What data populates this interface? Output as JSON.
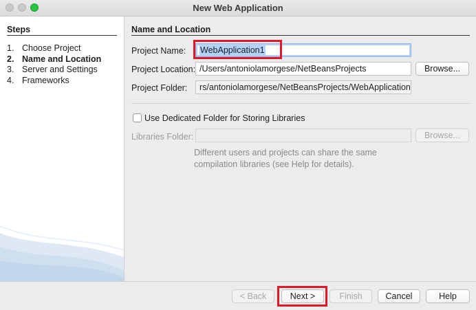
{
  "window": {
    "title": "New Web Application"
  },
  "steps": {
    "heading": "Steps",
    "items": [
      {
        "num": "1.",
        "label": "Choose Project"
      },
      {
        "num": "2.",
        "label": "Name and Location"
      },
      {
        "num": "3.",
        "label": "Server and Settings"
      },
      {
        "num": "4.",
        "label": "Frameworks"
      }
    ],
    "active_index": 1
  },
  "form": {
    "heading": "Name and Location",
    "project_name_label": "Project Name:",
    "project_name_value": "WebApplication1",
    "project_location_label": "Project Location:",
    "project_location_value": "/Users/antoniolamorgese/NetBeansProjects",
    "project_folder_label": "Project Folder:",
    "project_folder_value": "rs/antoniolamorgese/NetBeansProjects/WebApplication1",
    "browse_label": "Browse...",
    "dedicated_folder_label": "Use Dedicated Folder for Storing Libraries",
    "dedicated_folder_checked": false,
    "libraries_folder_label": "Libraries Folder:",
    "libraries_folder_value": "",
    "libraries_browse_label": "Browse...",
    "hint_line1": "Different users and projects can share the same",
    "hint_line2": "compilation libraries (see Help for details)."
  },
  "buttons": {
    "back": "< Back",
    "next": "Next >",
    "finish": "Finish",
    "cancel": "Cancel",
    "help": "Help"
  },
  "colors": {
    "highlight": "#e2162a",
    "selection": "#b3d3fd"
  }
}
